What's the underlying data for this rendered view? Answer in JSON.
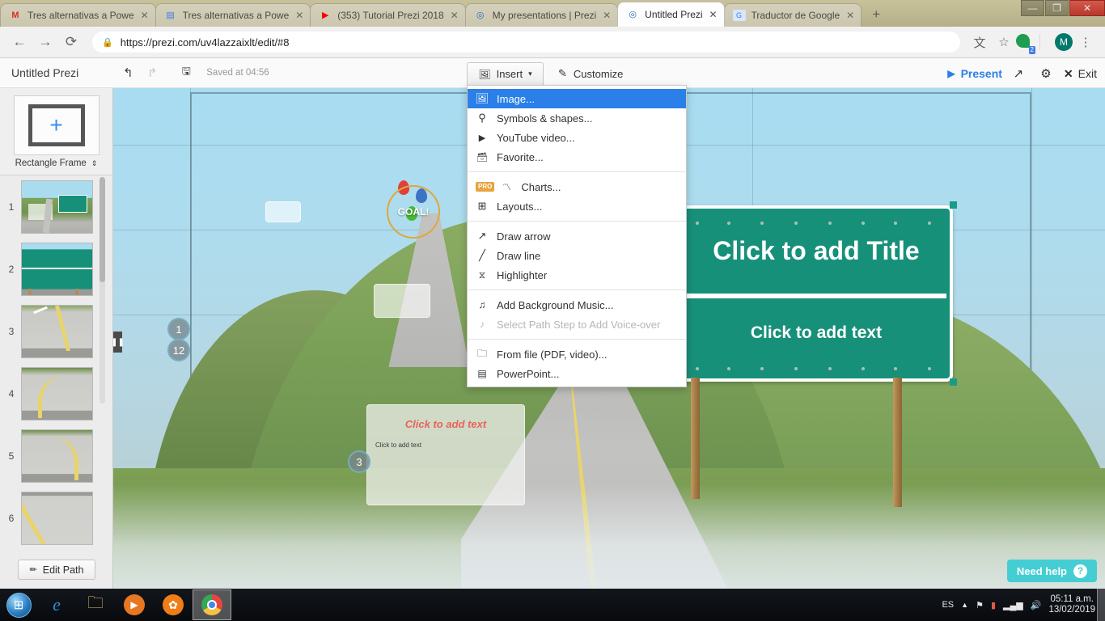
{
  "browser": {
    "tabs": [
      {
        "title": "Tres alternativas a Powe",
        "favicon": "M",
        "favicon_name": "gmail-icon",
        "active": false
      },
      {
        "title": "Tres alternativas a Powe",
        "favicon": "▤",
        "favicon_name": "google-docs-icon",
        "active": false
      },
      {
        "title": "(353) Tutorial Prezi 2018",
        "favicon": "▶",
        "favicon_name": "youtube-icon",
        "active": false
      },
      {
        "title": "My presentations | Prezi",
        "favicon": "◎",
        "favicon_name": "prezi-icon",
        "active": false
      },
      {
        "title": "Untitled Prezi",
        "favicon": "◎",
        "favicon_name": "prezi-icon",
        "active": true
      },
      {
        "title": "Traductor de Google",
        "favicon": "G",
        "favicon_name": "google-translate-icon",
        "active": false
      }
    ],
    "close_glyph": "✕",
    "new_tab_glyph": "+",
    "window_buttons": {
      "minimize": "—",
      "maximize": "❐",
      "close": "✕"
    },
    "nav": {
      "back": "←",
      "forward": "→",
      "reload": "⟳"
    },
    "url": "https://prezi.com/uv4lazzaixlt/edit/#8",
    "url_scheme": "https://",
    "lock_glyph": "🔒",
    "translate_glyph": "文",
    "star_glyph": "☆",
    "profile_initial": "M",
    "extension_badge": "2",
    "menu_glyph": "⋮"
  },
  "prezi": {
    "doc_title": "Untitled Prezi",
    "undo_glyph": "↰",
    "redo_glyph": "↱",
    "save_glyph": "💾",
    "saved_status": "Saved at 04:56",
    "insert_label": "Insert",
    "insert_caret": "▾",
    "insert_icon_glyph": "🖼",
    "customize_label": "Customize",
    "customize_icon_glyph": "✎",
    "present_label": "Present",
    "present_glyph": "▶",
    "share_glyph": "↗",
    "settings_glyph": "⚙",
    "exit_label": "Exit",
    "exit_glyph": "✕"
  },
  "sidebar": {
    "frame_label": "Rectangle Frame",
    "frame_caret": "⇕",
    "add_frame_glyph": "+",
    "thumbnails": [
      {
        "number": "1",
        "kind": "overview"
      },
      {
        "number": "2",
        "kind": "sign"
      },
      {
        "number": "3",
        "kind": "road-straight"
      },
      {
        "number": "4",
        "kind": "road-curve-left"
      },
      {
        "number": "5",
        "kind": "road-curve-right"
      },
      {
        "number": "6",
        "kind": "road-diagonal"
      }
    ],
    "edit_path_label": "Edit Path",
    "edit_path_glyph": "✏"
  },
  "insert_menu": {
    "items": [
      {
        "label": "Image...",
        "icon": "image-icon",
        "glyph": "🖼",
        "selected": true,
        "disabled": false,
        "pro": false
      },
      {
        "label": "Symbols & shapes...",
        "icon": "pin-icon",
        "glyph": "⚲",
        "selected": false,
        "disabled": false,
        "pro": false
      },
      {
        "label": "YouTube video...",
        "icon": "video-icon",
        "glyph": "▣",
        "selected": false,
        "disabled": false,
        "pro": false
      },
      {
        "label": "Favorite...",
        "icon": "archive-icon",
        "glyph": "▤",
        "selected": false,
        "disabled": false,
        "pro": false
      },
      {
        "separator": true
      },
      {
        "label": "Charts...",
        "icon": "chart-icon",
        "glyph": "〽",
        "selected": false,
        "disabled": false,
        "pro": true,
        "pro_label": "PRO"
      },
      {
        "label": "Layouts...",
        "icon": "layout-icon",
        "glyph": "⊞",
        "selected": false,
        "disabled": false,
        "pro": false
      },
      {
        "separator": true
      },
      {
        "label": "Draw arrow",
        "icon": "arrow-icon",
        "glyph": "↗",
        "selected": false,
        "disabled": false,
        "pro": false
      },
      {
        "label": "Draw line",
        "icon": "line-icon",
        "glyph": "╱",
        "selected": false,
        "disabled": false,
        "pro": false
      },
      {
        "label": "Highlighter",
        "icon": "highlighter-icon",
        "glyph": "≋",
        "selected": false,
        "disabled": false,
        "pro": false
      },
      {
        "separator": true
      },
      {
        "label": "Add Background Music...",
        "icon": "music-note-icon",
        "glyph": "♫",
        "selected": false,
        "disabled": false,
        "pro": false
      },
      {
        "label": "Select Path Step to Add Voice-over",
        "icon": "music-note-icon",
        "glyph": "♪",
        "selected": false,
        "disabled": true,
        "pro": false
      },
      {
        "separator": true
      },
      {
        "label": "From file (PDF, video)...",
        "icon": "folder-icon",
        "glyph": "▬",
        "selected": false,
        "disabled": false,
        "pro": false
      },
      {
        "label": "PowerPoint...",
        "icon": "powerpoint-icon",
        "glyph": "▤",
        "selected": false,
        "disabled": false,
        "pro": false
      }
    ]
  },
  "canvas": {
    "sign_title": "Click to add Title",
    "sign_subtitle": "Click to add text",
    "sign_color": "#17907a",
    "goal_label": "GOAL!",
    "card_heading": "Click to add text",
    "card_body": "Click to add text",
    "path_steps": [
      "1",
      "12",
      "3"
    ],
    "collapse_glyph": "❚❚",
    "need_help_label": "Need help",
    "need_help_glyph": "?"
  },
  "taskbar": {
    "start_glyph": "⊞",
    "apps": [
      {
        "name": "internet-explorer",
        "glyph": "e"
      },
      {
        "name": "file-explorer",
        "glyph": "🗀"
      },
      {
        "name": "media-player",
        "glyph": "▶"
      },
      {
        "name": "utorrent",
        "glyph": "✿"
      },
      {
        "name": "google-chrome",
        "glyph": "◉",
        "active": true
      }
    ],
    "language": "ES",
    "tray_up_glyph": "▲",
    "flag_glyph": "⚑",
    "network_glyph": "▮",
    "signal_glyph": "▂▄▆",
    "volume_glyph": "🔊",
    "time": "05:11 a.m.",
    "date": "13/02/2019"
  }
}
